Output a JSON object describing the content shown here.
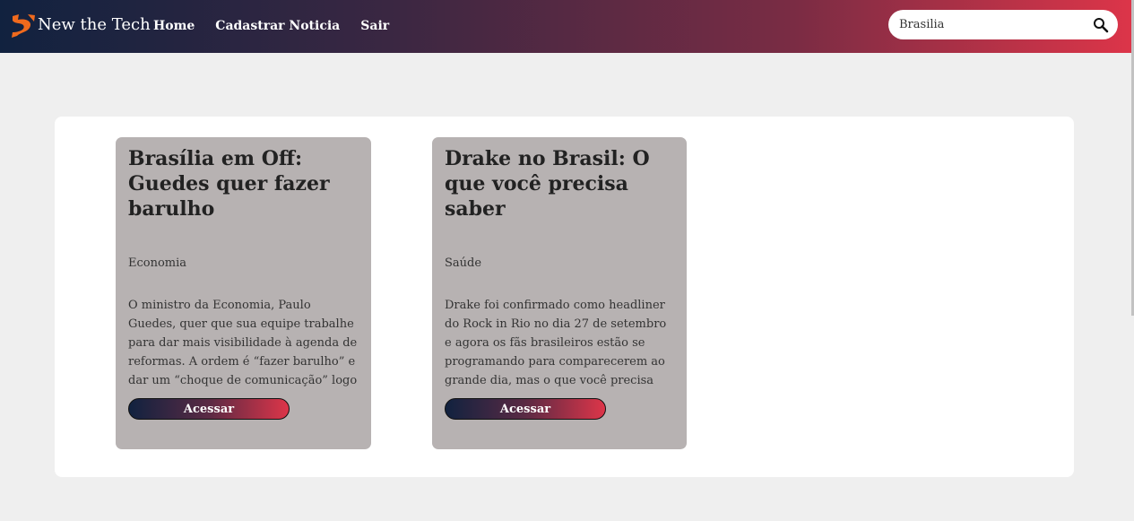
{
  "header": {
    "brand": "New the Tech",
    "logo_icon": "s-logo-icon",
    "nav": [
      "Home",
      "Cadastrar Noticia",
      "Sair"
    ],
    "search_value": "Brasilia",
    "search_icon": "search-icon"
  },
  "colors": {
    "nav_gradient_start": "#11223f",
    "nav_gradient_end": "#dd3549",
    "logo_orange": "#f06a1d",
    "card_bg": "#b7b2b2"
  },
  "cards": [
    {
      "title": "Brasília em Off: Guedes quer fazer barulho",
      "category": "Economia",
      "excerpt": "O ministro da Economia, Paulo Guedes, quer que sua equipe trabalhe para dar mais visibilidade à agenda de reformas. A ordem é “fazer barulho” e dar um “choque de comunicação” logo após as…",
      "button": "Acessar"
    },
    {
      "title": "Drake no Brasil: O que você precisa saber",
      "category": "Saúde",
      "excerpt": "Drake foi confirmado como headliner do Rock in Rio no dia 27 de setembro e agora os fãs brasileiros estão se programando para comparecerem ao grande dia, mas o que você precisa saber para ter mais…",
      "button": "Acessar"
    }
  ]
}
